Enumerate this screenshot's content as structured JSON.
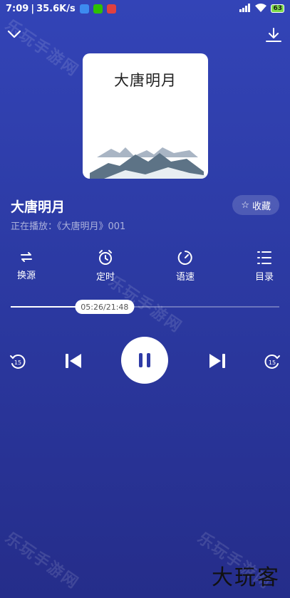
{
  "status_bar": {
    "time": "7:09",
    "speed": "35.6K/s",
    "battery": "63"
  },
  "cover": {
    "title": "大唐明月"
  },
  "book": {
    "title": "大唐明月",
    "now_playing": "正在播放：《大唐明月》001"
  },
  "favorite": {
    "icon": "☆",
    "label": "收藏"
  },
  "tools": [
    {
      "label": "换源",
      "icon": "swap-icon"
    },
    {
      "label": "定时",
      "icon": "alarm-clock-icon"
    },
    {
      "label": "语速",
      "icon": "speed-icon"
    },
    {
      "label": "目录",
      "icon": "list-icon"
    }
  ],
  "playback": {
    "elapsed": "05:26",
    "total": "21:48",
    "time_display": "05:26/21:48",
    "progress_fraction": 0.249
  },
  "controls": {
    "rewind_seconds": "15",
    "forward_seconds": "15",
    "state": "playing"
  },
  "watermarks": [
    "乐玩手游网",
    "乐玩手游网",
    "乐玩手游网",
    "乐玩手游网"
  ],
  "corner_logo": "大玩客",
  "colors": {
    "background_top": "#3344b7",
    "background_bottom": "#252d8a",
    "accent": "#ffffff"
  }
}
